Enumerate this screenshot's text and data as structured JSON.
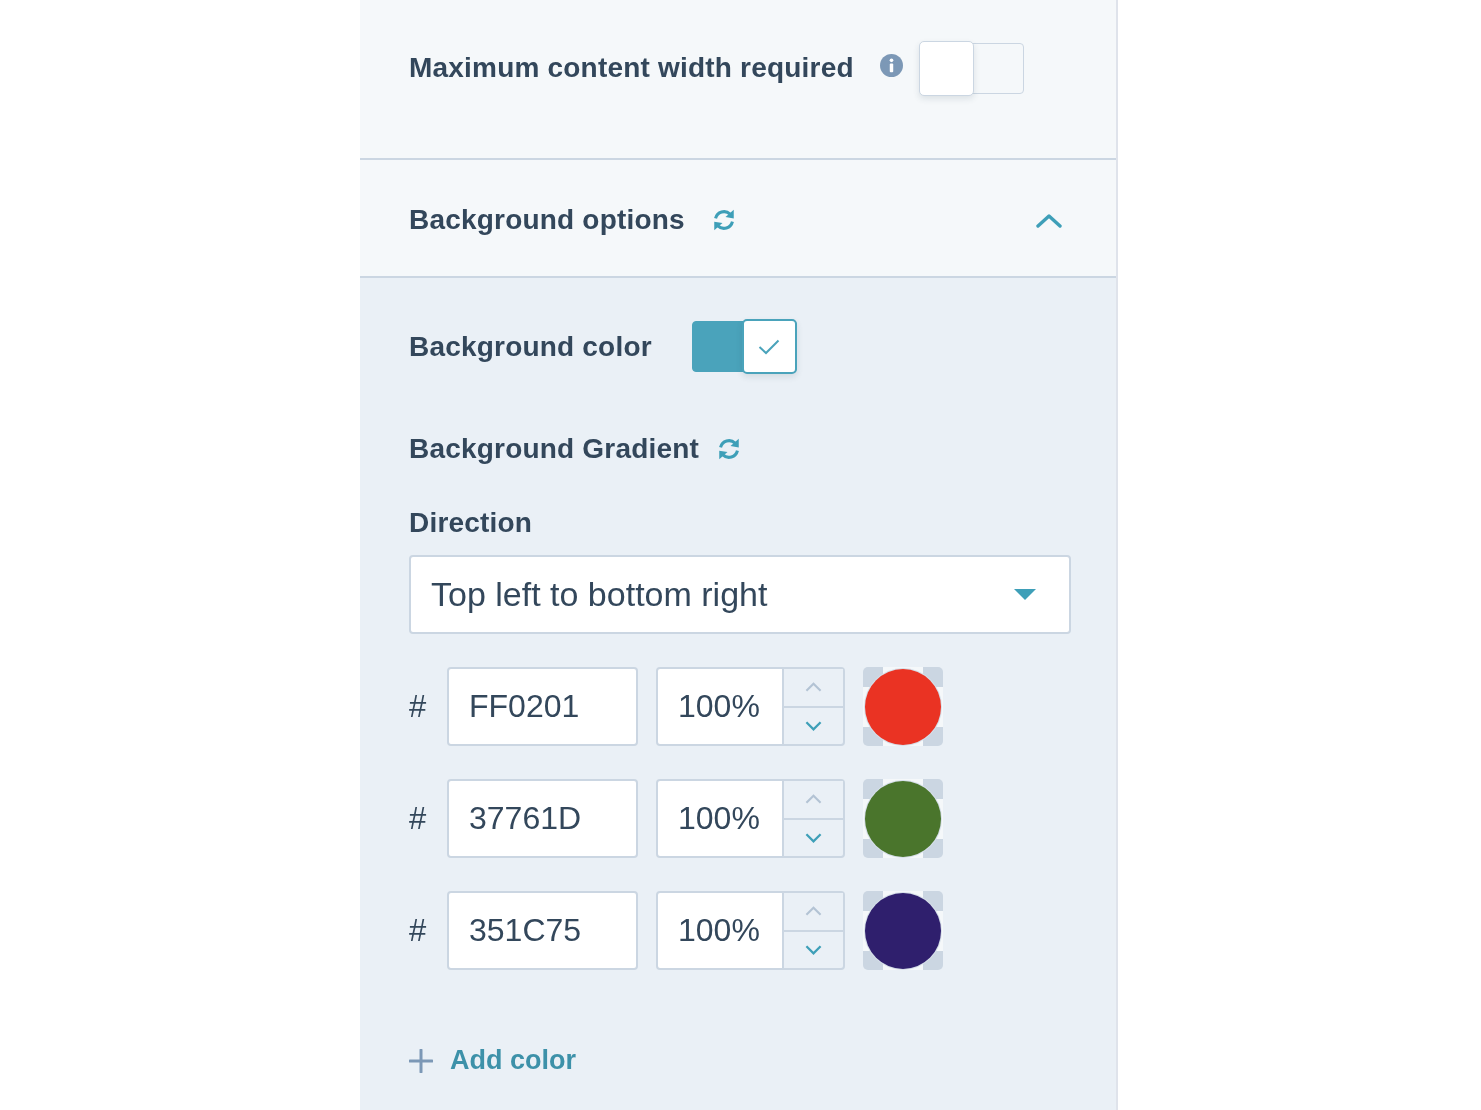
{
  "max_width_setting": {
    "label": "Maximum content width required",
    "on": false
  },
  "background_options": {
    "title": "Background options",
    "expanded": true,
    "background_color": {
      "label": "Background color",
      "on": true
    },
    "gradient": {
      "title": "Background Gradient",
      "direction": {
        "label": "Direction",
        "value": "Top left to bottom right"
      },
      "colors": [
        {
          "prefix": "#",
          "hex": "FF0201",
          "opacity": "100%",
          "increment_disabled": true,
          "color": "#ea3323"
        },
        {
          "prefix": "#",
          "hex": "37761D",
          "opacity": "100%",
          "increment_disabled": true,
          "color": "#4a752c"
        },
        {
          "prefix": "#",
          "hex": "351C75",
          "opacity": "100%",
          "increment_disabled": true,
          "color": "#2f1f6d"
        }
      ],
      "add_button": "Add color"
    }
  }
}
